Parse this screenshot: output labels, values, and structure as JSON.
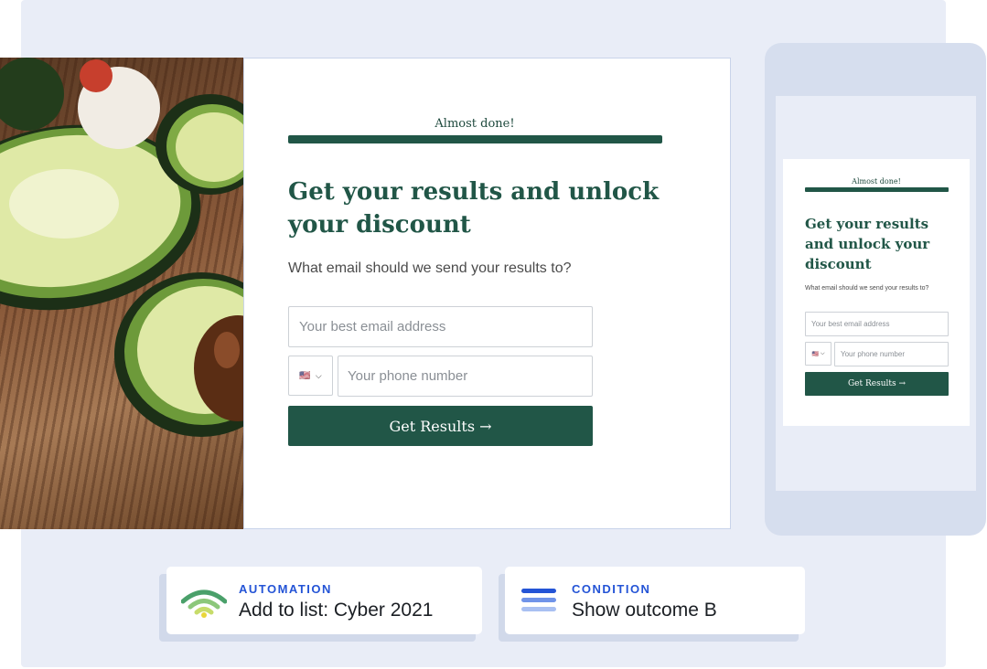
{
  "colors": {
    "brand_green": "#215647",
    "panel_bg": "#e9edf7",
    "accent_blue": "#2454d6"
  },
  "desktop": {
    "image": "avocado-halves-on-wooden-board",
    "progress_label": "Almost done!",
    "headline": "Get your results and unlock your discount",
    "subtext": "What email should we send your results to?",
    "email_placeholder": "Your best email address",
    "country_flag": "🇺🇸",
    "phone_placeholder": "Your phone number",
    "submit_label": "Get Results →"
  },
  "mobile": {
    "progress_label": "Almost done!",
    "headline": "Get your results and unlock your discount",
    "subtext": "What email should we send your results to?",
    "email_placeholder": "Your best email address",
    "country_flag": "🇺🇸",
    "phone_placeholder": "Your phone number",
    "submit_label": "Get Results →"
  },
  "automation": {
    "kicker": "AUTOMATION",
    "text": "Add to list: Cyber 2021",
    "icon": "wifi-signal-icon"
  },
  "condition": {
    "kicker": "CONDITION",
    "text": "Show outcome B",
    "icon": "stacked-lines-icon"
  }
}
